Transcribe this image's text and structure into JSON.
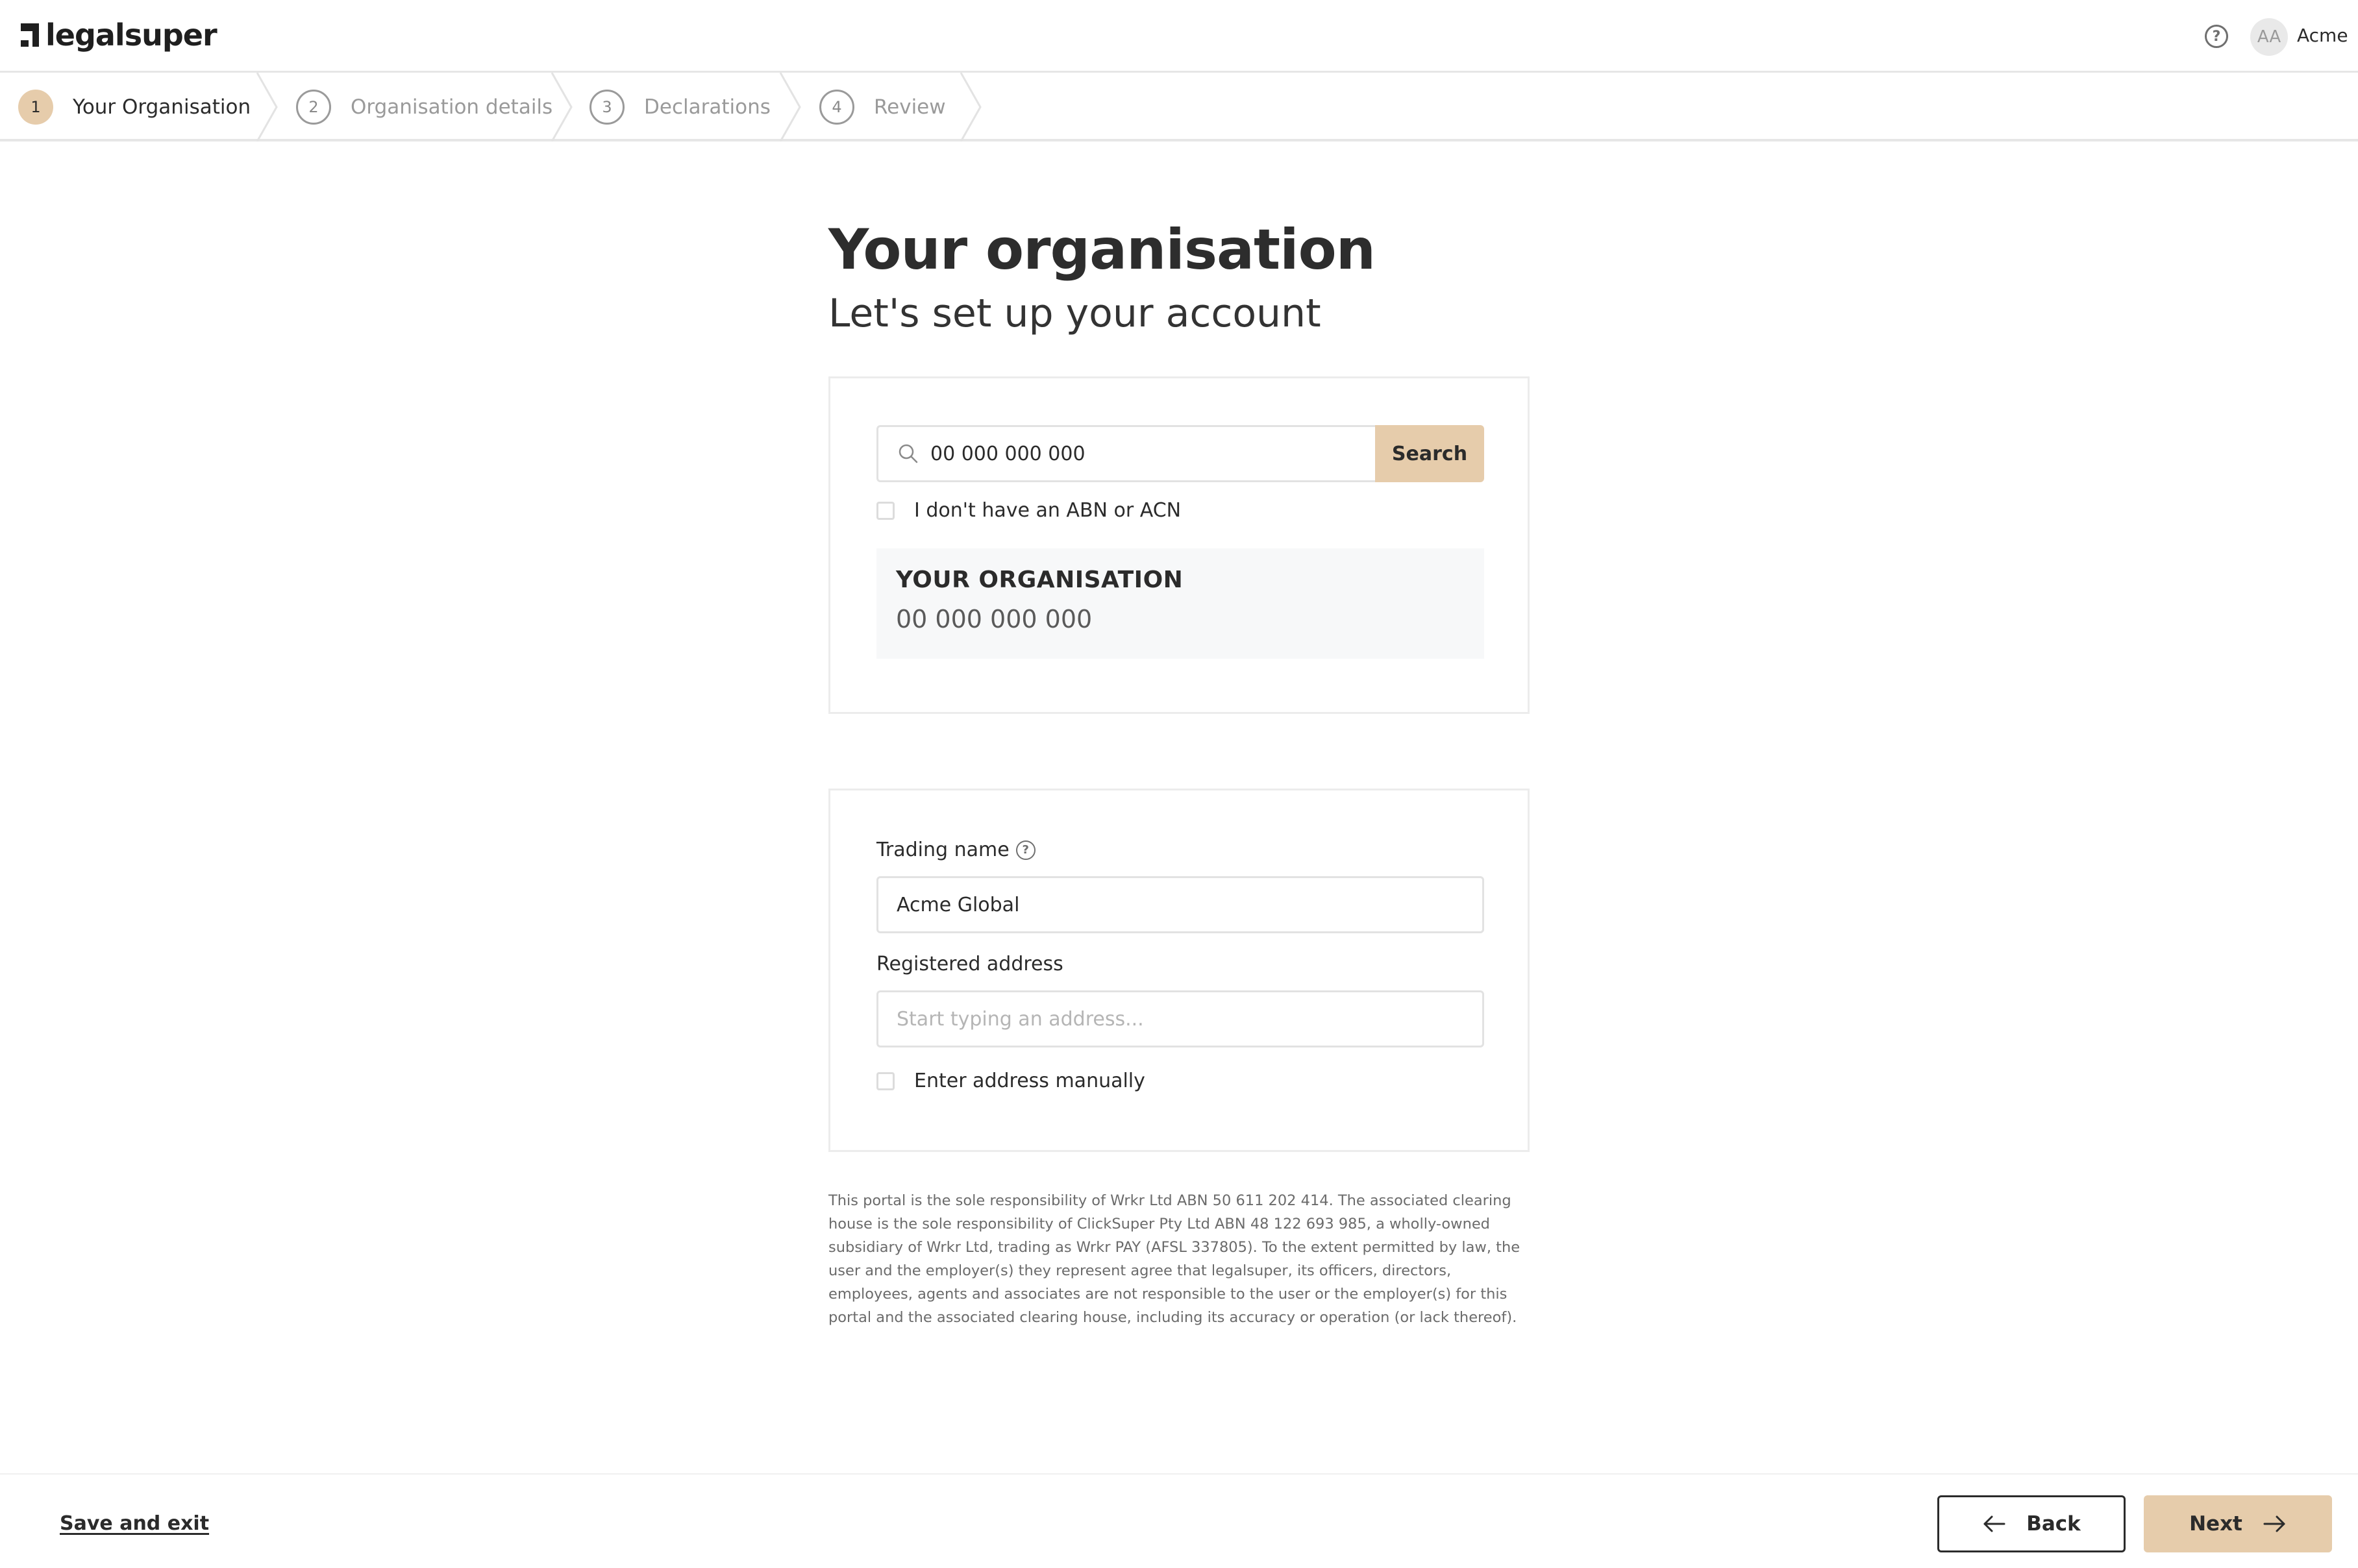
{
  "header": {
    "brand": "legalsuper",
    "help_icon": "question-circle-icon",
    "avatar_initials": "AA",
    "user_name": "Acme"
  },
  "stepper": {
    "active_step": 1,
    "steps": [
      {
        "number": "1",
        "label": "Your Organisation"
      },
      {
        "number": "2",
        "label": "Organisation details"
      },
      {
        "number": "3",
        "label": "Declarations"
      },
      {
        "number": "4",
        "label": "Review"
      }
    ]
  },
  "main": {
    "title": "Your organisation",
    "subtitle": "Let's set up your account",
    "search": {
      "value": "00 000 000 000",
      "button_label": "Search"
    },
    "no_abn_checkbox_label": "I don't have an ABN or ACN",
    "no_abn_checked": false,
    "organisation": {
      "name": "YOUR ORGANISATION",
      "abn": "00 000 000 000"
    },
    "trading_name": {
      "label": "Trading name",
      "value": "Acme Global"
    },
    "registered_address": {
      "label": "Registered address",
      "placeholder": "Start typing an address..."
    },
    "manual_address_checkbox_label": "Enter address manually",
    "manual_address_checked": false,
    "disclaimer": "This portal is the sole responsibility of Wrkr Ltd ABN 50 611 202 414. The associated clearing house is the sole responsibility of ClickSuper Pty Ltd ABN 48 122 693 985, a wholly-owned subsidiary of Wrkr Ltd, trading as Wrkr PAY (AFSL 337805). To the extent permitted by law, the user and the employer(s) they represent agree that legalsuper, its officers, directors, employees, agents and associates are not responsible to the user or the employer(s) for this portal and the associated clearing house, including its accuracy or operation (or lack thereof)."
  },
  "footer": {
    "save_exit_label": "Save and exit",
    "back_label": "Back",
    "next_label": "Next"
  },
  "colors": {
    "accent": "#e6ccab",
    "text": "#2b2b2b",
    "muted": "#9a9a9a",
    "border": "#e2e2e2"
  }
}
